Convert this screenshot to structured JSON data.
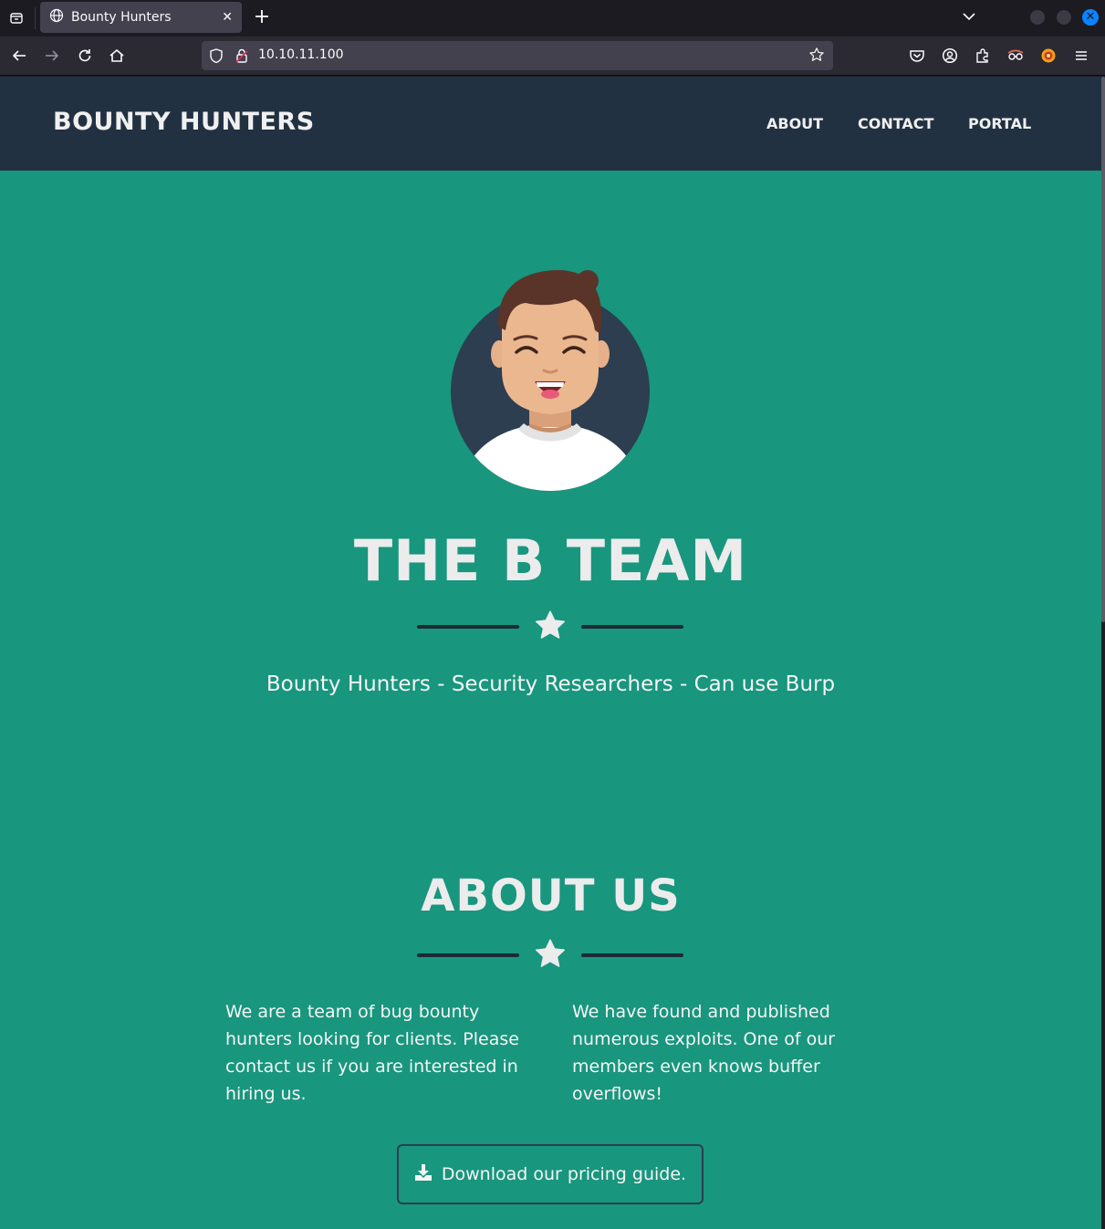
{
  "browser": {
    "tab_title": "Bounty Hunters",
    "url": "10.10.11.100"
  },
  "site": {
    "brand": "BOUNTY HUNTERS",
    "nav": [
      "ABOUT",
      "CONTACT",
      "PORTAL"
    ]
  },
  "hero": {
    "title": "THE B TEAM",
    "subtitle": "Bounty Hunters - Security Researchers - Can use Burp"
  },
  "about": {
    "title": "ABOUT US",
    "col1": "We are a team of bug bounty hunters looking for clients. Please contact us if you are interested in hiring us.",
    "col2": "We have found and published numerous exploits. One of our members even knows buffer overflows!",
    "download_label": "Download our pricing guide."
  },
  "colors": {
    "page_bg": "#18967e",
    "nav_bg": "#223142",
    "text_light": "#ececec"
  }
}
